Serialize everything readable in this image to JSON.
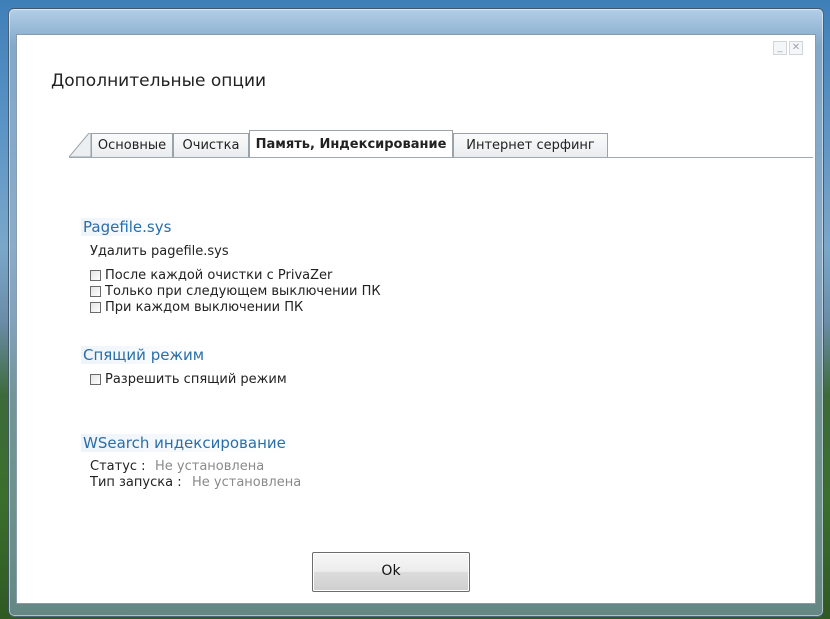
{
  "window": {
    "title": "Дополнительные опции",
    "minimize_glyph": "_",
    "close_glyph": "✕"
  },
  "tabs": [
    {
      "label": "Основные",
      "active": false
    },
    {
      "label": "Очистка",
      "active": false
    },
    {
      "label": "Память, Индексирование",
      "active": true
    },
    {
      "label": "Интернет серфинг",
      "active": false
    }
  ],
  "pagefile": {
    "title": "Pagefile.sys",
    "subtitle": "Удалить pagefile.sys",
    "options": [
      {
        "label": "После каждой очистки с PrivaZer",
        "checked": false
      },
      {
        "label": "Только при следующем выключении ПК",
        "checked": false
      },
      {
        "label": "При каждом выключении ПК",
        "checked": false
      }
    ]
  },
  "sleep": {
    "title": "Спящий режим",
    "option": {
      "label": "Разрешить спящий режим",
      "checked": false
    }
  },
  "wsearch": {
    "title": "WSearch индексирование",
    "status_label": "Статус :",
    "status_value": "Не установлена",
    "startup_label": "Тип запуска :",
    "startup_value": "Не установлена"
  },
  "ok_button": {
    "label": "Ok"
  },
  "colors": {
    "section_title": "#2b6ea7",
    "muted_text": "#8a8a8a"
  }
}
